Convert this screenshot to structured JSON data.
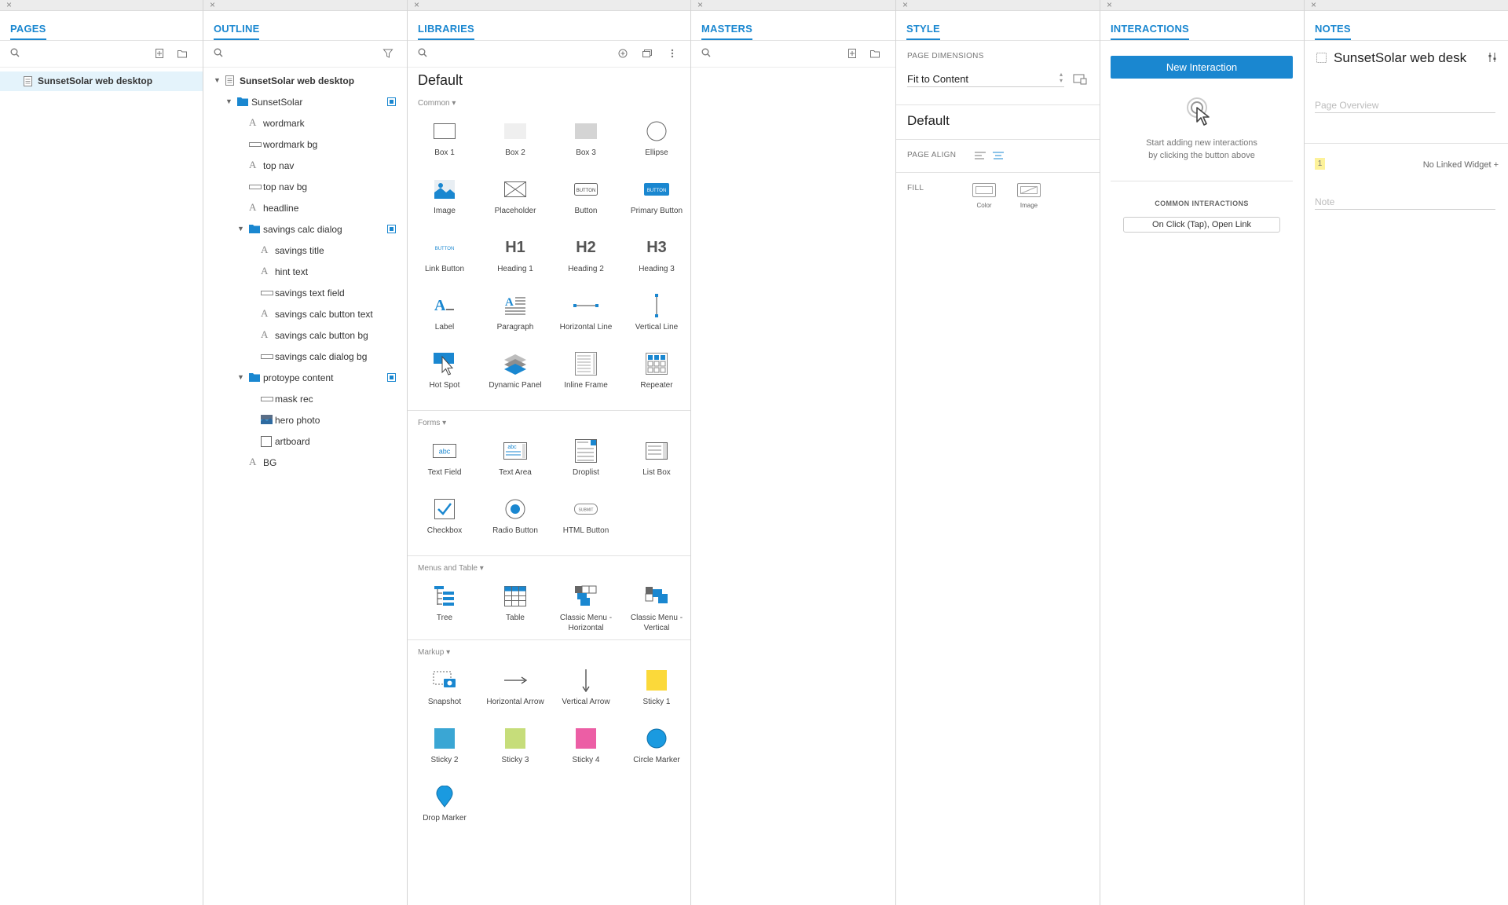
{
  "panels": {
    "pages": {
      "title": "PAGES",
      "items": [
        {
          "label": "SunsetSolar web desktop"
        }
      ]
    },
    "outline": {
      "title": "OUTLINE",
      "root": "SunsetSolar web desktop",
      "items": [
        {
          "label": "SunsetSolar",
          "kind": "folder"
        },
        {
          "label": "wordmark",
          "kind": "text"
        },
        {
          "label": "wordmark bg",
          "kind": "rect"
        },
        {
          "label": "top nav",
          "kind": "text"
        },
        {
          "label": "top nav bg",
          "kind": "rect"
        },
        {
          "label": "headline",
          "kind": "text"
        },
        {
          "label": "savings calc dialog",
          "kind": "folder"
        },
        {
          "label": "savings title",
          "kind": "text"
        },
        {
          "label": "hint text",
          "kind": "text"
        },
        {
          "label": "savings text field",
          "kind": "rect"
        },
        {
          "label": "savings calc button text",
          "kind": "text"
        },
        {
          "label": "savings calc button bg",
          "kind": "text"
        },
        {
          "label": "savings calc dialog bg",
          "kind": "rect"
        },
        {
          "label": "protoype content",
          "kind": "folder"
        },
        {
          "label": "mask rec",
          "kind": "rect"
        },
        {
          "label": "hero photo",
          "kind": "image"
        },
        {
          "label": "artboard",
          "kind": "box"
        },
        {
          "label": "BG",
          "kind": "text"
        }
      ]
    },
    "libraries": {
      "title": "LIBRARIES",
      "library_name": "Default",
      "sections": [
        {
          "name": "Common ▾",
          "widgets": [
            "Box 1",
            "Box 2",
            "Box 3",
            "Ellipse",
            "Image",
            "Placeholder",
            "Button",
            "Primary Button",
            "Link Button",
            "Heading 1",
            "Heading 2",
            "Heading 3",
            "Label",
            "Paragraph",
            "Horizontal Line",
            "Vertical Line",
            "Hot Spot",
            "Dynamic Panel",
            "Inline Frame",
            "Repeater"
          ]
        },
        {
          "name": "Forms ▾",
          "widgets": [
            "Text Field",
            "Text Area",
            "Droplist",
            "List Box",
            "Checkbox",
            "Radio Button",
            "HTML Button"
          ]
        },
        {
          "name": "Menus and Table ▾",
          "widgets": [
            "Tree",
            "Table",
            "Classic Menu - Horizontal",
            "Classic Menu - Vertical"
          ]
        },
        {
          "name": "Markup ▾",
          "widgets": [
            "Snapshot",
            "Horizontal Arrow",
            "Vertical Arrow",
            "Sticky 1",
            "Sticky 2",
            "Sticky 3",
            "Sticky 4",
            "Circle Marker",
            "Drop Marker"
          ]
        }
      ],
      "icon_text": {
        "button": "BUTTON",
        "primary": "BUTTON",
        "link": "BUTTON",
        "h1": "H1",
        "h2": "H2",
        "h3": "H3",
        "label": "A",
        "paragraph": "A",
        "textfield": "abc",
        "textarea": "abc",
        "htmlbutton": "SUBMIT"
      }
    },
    "masters": {
      "title": "MASTERS"
    },
    "style": {
      "title": "STYLE",
      "page_dimensions_label": "PAGE DIMENSIONS",
      "page_dimensions_value": "Fit to Content",
      "style_name": "Default",
      "page_align_label": "PAGE ALIGN",
      "fill_label": "FILL",
      "fill_color_label": "Color",
      "fill_image_label": "Image"
    },
    "interactions": {
      "title": "INTERACTIONS",
      "new_button": "New Interaction",
      "hint_line1": "Start adding new interactions",
      "hint_line2": "by clicking the button above",
      "common_label": "COMMON INTERACTIONS",
      "common_item": "On Click (Tap), Open Link"
    },
    "notes": {
      "title": "NOTES",
      "page_title": "SunsetSolar web desk",
      "overview_placeholder": "Page Overview",
      "note_number": "1",
      "linked_widget": "No Linked Widget +",
      "note_placeholder": "Note"
    }
  },
  "colors": {
    "accent": "#1a87d0",
    "selection": "#e4f3fb",
    "sticky1": "#fbd93a",
    "sticky2": "#3aa6d4",
    "sticky3": "#c6dd7a",
    "sticky4": "#ec5ea5",
    "circle_marker": "#1a9ae0"
  }
}
